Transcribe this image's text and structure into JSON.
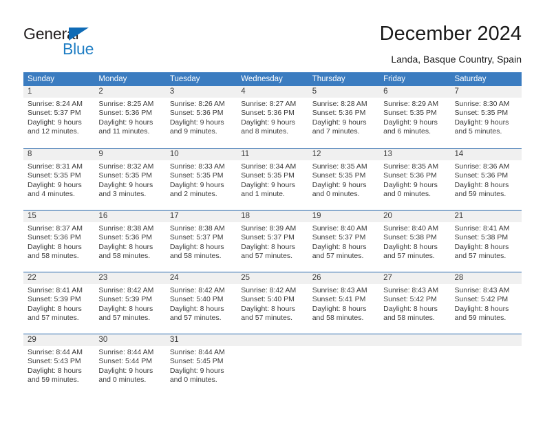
{
  "brand": {
    "name_part1": "General",
    "name_part2": "Blue",
    "triangle_color": "#0f6bb6",
    "blue_color": "#1f7ec4",
    "dark_color": "#231f20"
  },
  "header": {
    "title": "December 2024",
    "subtitle": "Landa, Basque Country, Spain"
  },
  "theme": {
    "header_bg": "#3b7cc0",
    "header_text": "#ffffff",
    "week_border": "#2466ac",
    "daynum_band_bg": "#f0f0f0",
    "cell_text": "#3a3a3a"
  },
  "calendar": {
    "weekday_headers": [
      "Sunday",
      "Monday",
      "Tuesday",
      "Wednesday",
      "Thursday",
      "Friday",
      "Saturday"
    ],
    "weeks": [
      [
        {
          "day": "1",
          "sunrise": "Sunrise: 8:24 AM",
          "sunset": "Sunset: 5:37 PM",
          "daylight_line1": "Daylight: 9 hours",
          "daylight_line2": "and 12 minutes."
        },
        {
          "day": "2",
          "sunrise": "Sunrise: 8:25 AM",
          "sunset": "Sunset: 5:36 PM",
          "daylight_line1": "Daylight: 9 hours",
          "daylight_line2": "and 11 minutes."
        },
        {
          "day": "3",
          "sunrise": "Sunrise: 8:26 AM",
          "sunset": "Sunset: 5:36 PM",
          "daylight_line1": "Daylight: 9 hours",
          "daylight_line2": "and 9 minutes."
        },
        {
          "day": "4",
          "sunrise": "Sunrise: 8:27 AM",
          "sunset": "Sunset: 5:36 PM",
          "daylight_line1": "Daylight: 9 hours",
          "daylight_line2": "and 8 minutes."
        },
        {
          "day": "5",
          "sunrise": "Sunrise: 8:28 AM",
          "sunset": "Sunset: 5:36 PM",
          "daylight_line1": "Daylight: 9 hours",
          "daylight_line2": "and 7 minutes."
        },
        {
          "day": "6",
          "sunrise": "Sunrise: 8:29 AM",
          "sunset": "Sunset: 5:35 PM",
          "daylight_line1": "Daylight: 9 hours",
          "daylight_line2": "and 6 minutes."
        },
        {
          "day": "7",
          "sunrise": "Sunrise: 8:30 AM",
          "sunset": "Sunset: 5:35 PM",
          "daylight_line1": "Daylight: 9 hours",
          "daylight_line2": "and 5 minutes."
        }
      ],
      [
        {
          "day": "8",
          "sunrise": "Sunrise: 8:31 AM",
          "sunset": "Sunset: 5:35 PM",
          "daylight_line1": "Daylight: 9 hours",
          "daylight_line2": "and 4 minutes."
        },
        {
          "day": "9",
          "sunrise": "Sunrise: 8:32 AM",
          "sunset": "Sunset: 5:35 PM",
          "daylight_line1": "Daylight: 9 hours",
          "daylight_line2": "and 3 minutes."
        },
        {
          "day": "10",
          "sunrise": "Sunrise: 8:33 AM",
          "sunset": "Sunset: 5:35 PM",
          "daylight_line1": "Daylight: 9 hours",
          "daylight_line2": "and 2 minutes."
        },
        {
          "day": "11",
          "sunrise": "Sunrise: 8:34 AM",
          "sunset": "Sunset: 5:35 PM",
          "daylight_line1": "Daylight: 9 hours",
          "daylight_line2": "and 1 minute."
        },
        {
          "day": "12",
          "sunrise": "Sunrise: 8:35 AM",
          "sunset": "Sunset: 5:35 PM",
          "daylight_line1": "Daylight: 9 hours",
          "daylight_line2": "and 0 minutes."
        },
        {
          "day": "13",
          "sunrise": "Sunrise: 8:35 AM",
          "sunset": "Sunset: 5:36 PM",
          "daylight_line1": "Daylight: 9 hours",
          "daylight_line2": "and 0 minutes."
        },
        {
          "day": "14",
          "sunrise": "Sunrise: 8:36 AM",
          "sunset": "Sunset: 5:36 PM",
          "daylight_line1": "Daylight: 8 hours",
          "daylight_line2": "and 59 minutes."
        }
      ],
      [
        {
          "day": "15",
          "sunrise": "Sunrise: 8:37 AM",
          "sunset": "Sunset: 5:36 PM",
          "daylight_line1": "Daylight: 8 hours",
          "daylight_line2": "and 58 minutes."
        },
        {
          "day": "16",
          "sunrise": "Sunrise: 8:38 AM",
          "sunset": "Sunset: 5:36 PM",
          "daylight_line1": "Daylight: 8 hours",
          "daylight_line2": "and 58 minutes."
        },
        {
          "day": "17",
          "sunrise": "Sunrise: 8:38 AM",
          "sunset": "Sunset: 5:37 PM",
          "daylight_line1": "Daylight: 8 hours",
          "daylight_line2": "and 58 minutes."
        },
        {
          "day": "18",
          "sunrise": "Sunrise: 8:39 AM",
          "sunset": "Sunset: 5:37 PM",
          "daylight_line1": "Daylight: 8 hours",
          "daylight_line2": "and 57 minutes."
        },
        {
          "day": "19",
          "sunrise": "Sunrise: 8:40 AM",
          "sunset": "Sunset: 5:37 PM",
          "daylight_line1": "Daylight: 8 hours",
          "daylight_line2": "and 57 minutes."
        },
        {
          "day": "20",
          "sunrise": "Sunrise: 8:40 AM",
          "sunset": "Sunset: 5:38 PM",
          "daylight_line1": "Daylight: 8 hours",
          "daylight_line2": "and 57 minutes."
        },
        {
          "day": "21",
          "sunrise": "Sunrise: 8:41 AM",
          "sunset": "Sunset: 5:38 PM",
          "daylight_line1": "Daylight: 8 hours",
          "daylight_line2": "and 57 minutes."
        }
      ],
      [
        {
          "day": "22",
          "sunrise": "Sunrise: 8:41 AM",
          "sunset": "Sunset: 5:39 PM",
          "daylight_line1": "Daylight: 8 hours",
          "daylight_line2": "and 57 minutes."
        },
        {
          "day": "23",
          "sunrise": "Sunrise: 8:42 AM",
          "sunset": "Sunset: 5:39 PM",
          "daylight_line1": "Daylight: 8 hours",
          "daylight_line2": "and 57 minutes."
        },
        {
          "day": "24",
          "sunrise": "Sunrise: 8:42 AM",
          "sunset": "Sunset: 5:40 PM",
          "daylight_line1": "Daylight: 8 hours",
          "daylight_line2": "and 57 minutes."
        },
        {
          "day": "25",
          "sunrise": "Sunrise: 8:42 AM",
          "sunset": "Sunset: 5:40 PM",
          "daylight_line1": "Daylight: 8 hours",
          "daylight_line2": "and 57 minutes."
        },
        {
          "day": "26",
          "sunrise": "Sunrise: 8:43 AM",
          "sunset": "Sunset: 5:41 PM",
          "daylight_line1": "Daylight: 8 hours",
          "daylight_line2": "and 58 minutes."
        },
        {
          "day": "27",
          "sunrise": "Sunrise: 8:43 AM",
          "sunset": "Sunset: 5:42 PM",
          "daylight_line1": "Daylight: 8 hours",
          "daylight_line2": "and 58 minutes."
        },
        {
          "day": "28",
          "sunrise": "Sunrise: 8:43 AM",
          "sunset": "Sunset: 5:42 PM",
          "daylight_line1": "Daylight: 8 hours",
          "daylight_line2": "and 59 minutes."
        }
      ],
      [
        {
          "day": "29",
          "sunrise": "Sunrise: 8:44 AM",
          "sunset": "Sunset: 5:43 PM",
          "daylight_line1": "Daylight: 8 hours",
          "daylight_line2": "and 59 minutes."
        },
        {
          "day": "30",
          "sunrise": "Sunrise: 8:44 AM",
          "sunset": "Sunset: 5:44 PM",
          "daylight_line1": "Daylight: 9 hours",
          "daylight_line2": "and 0 minutes."
        },
        {
          "day": "31",
          "sunrise": "Sunrise: 8:44 AM",
          "sunset": "Sunset: 5:45 PM",
          "daylight_line1": "Daylight: 9 hours",
          "daylight_line2": "and 0 minutes."
        },
        {
          "day": "",
          "sunrise": "",
          "sunset": "",
          "daylight_line1": "",
          "daylight_line2": ""
        },
        {
          "day": "",
          "sunrise": "",
          "sunset": "",
          "daylight_line1": "",
          "daylight_line2": ""
        },
        {
          "day": "",
          "sunrise": "",
          "sunset": "",
          "daylight_line1": "",
          "daylight_line2": ""
        },
        {
          "day": "",
          "sunrise": "",
          "sunset": "",
          "daylight_line1": "",
          "daylight_line2": ""
        }
      ]
    ]
  }
}
